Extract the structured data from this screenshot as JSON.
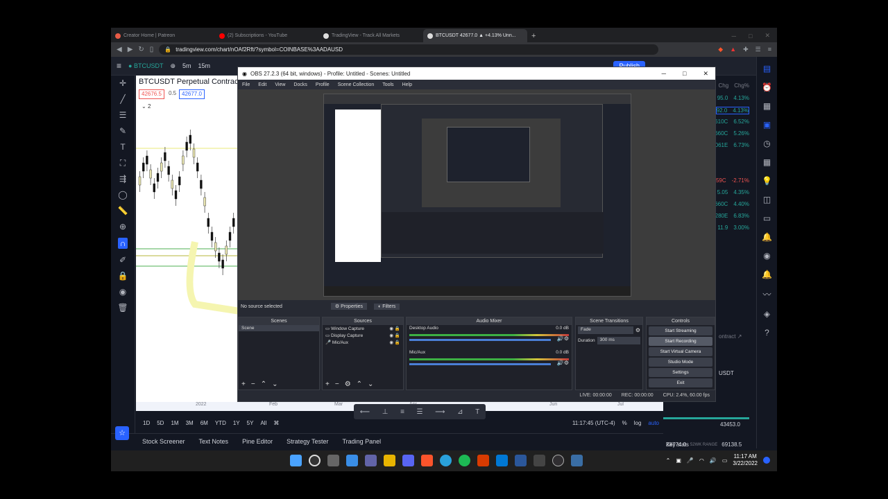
{
  "browser": {
    "tabs": [
      "Creator Home | Patreon",
      "(2) Subscriptions - YouTube",
      "TradingView - Track All Markets",
      "BTCUSDT 42677.0 ▲ +4.13% Unn..."
    ],
    "url": "tradingview.com/chart/nOAf2Rft/?symbol=COINBASE%3AADAUSD"
  },
  "tv": {
    "symbol": "BTCUSDT",
    "intervals": [
      "5m",
      "15m"
    ],
    "publish": "Publish",
    "chart_title": "BTCUSDT Perpetual Contract",
    "bid": "42676.5",
    "spread": "0.5",
    "ask": "42677.0",
    "indicator_count": "2",
    "x_labels": [
      "2022",
      "Feb",
      "Mar",
      "Apr",
      "Jun",
      "Jul"
    ],
    "ranges": [
      "1D",
      "5D",
      "1M",
      "3M",
      "6M",
      "YTD",
      "1Y",
      "5Y",
      "All"
    ],
    "time": "11:17:45 (UTC-4)",
    "scale": [
      "%",
      "log",
      "auto"
    ],
    "bottom_tabs": [
      "Stock Screener",
      "Text Notes",
      "Pine Editor",
      "Strategy Tester",
      "Trading Panel"
    ],
    "watch_header": [
      "Chg",
      "Chg%"
    ],
    "watch_rows": [
      {
        "chg": "95.0",
        "pct": "4.13%"
      },
      {
        "chg": "92.0",
        "pct": "4.13%"
      },
      {
        "chg": "610C",
        "pct": "6.52%"
      },
      {
        "chg": "660C",
        "pct": "5.26%"
      },
      {
        "chg": "061E",
        "pct": "6.73%"
      },
      {
        "chg": "59C",
        "pct": "-2.71%"
      },
      {
        "chg": "5.05",
        "pct": "4.35%"
      },
      {
        "chg": "660C",
        "pct": "4.40%"
      },
      {
        "chg": "280E",
        "pct": "6.83%"
      },
      {
        "chg": "11.9",
        "pct": "3.00%"
      }
    ],
    "details_contract": "ontract",
    "details_quote": "USDT",
    "day_high": "43453.0",
    "week_low": "28774.0",
    "range_label": "52WK RANGE",
    "week_high": "69138.5",
    "key_stats": "Key stats"
  },
  "obs": {
    "title": "OBS 27.2.3 (64 bit, windows) - Profile: Untitled - Scenes: Untitled",
    "menu": [
      "File",
      "Edit",
      "View",
      "Docks",
      "Profile",
      "Scene Collection",
      "Tools",
      "Help"
    ],
    "no_source": "No source selected",
    "properties": "Properties",
    "filters": "Filters",
    "docks": {
      "scenes": "Scenes",
      "sources": "Sources",
      "mixer": "Audio Mixer",
      "transitions": "Scene Transitions",
      "controls": "Controls"
    },
    "scene_list": [
      "Scene"
    ],
    "source_list": [
      "Window Capture",
      "Display Capture",
      "Mic/Aux"
    ],
    "mixer_channels": [
      {
        "name": "Desktop Audio",
        "db": "0.0 dB"
      },
      {
        "name": "Mic/Aux",
        "db": "0.0 dB"
      }
    ],
    "transition": "Fade",
    "duration_label": "Duration",
    "duration": "300 ms",
    "controls": [
      "Start Streaming",
      "Start Recording",
      "Start Virtual Camera",
      "Studio Mode",
      "Settings",
      "Exit"
    ],
    "live": "LIVE: 00:00:00",
    "rec": "REC: 00:00:00",
    "cpu": "CPU: 2.4%, 60.00 fps"
  },
  "taskbar": {
    "time": "11:17 AM",
    "date": "3/22/2022"
  }
}
